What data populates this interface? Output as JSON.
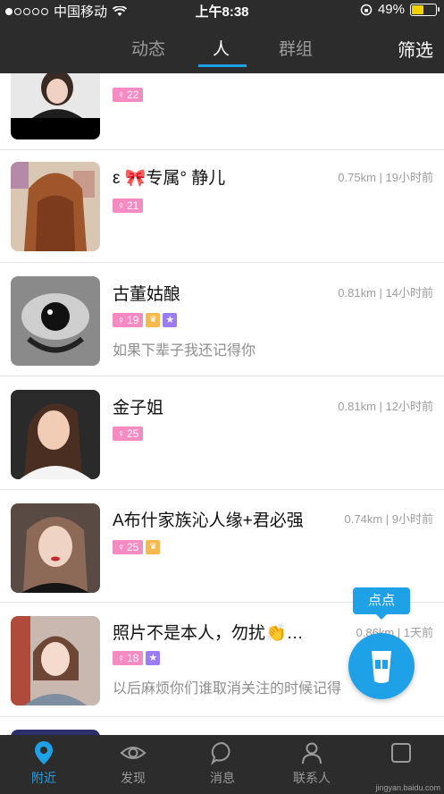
{
  "status_bar": {
    "carrier": "中国移动",
    "time": "上午8:38",
    "battery": "49%",
    "battery_level": 0.49
  },
  "top_nav": {
    "tabs": [
      {
        "label": "动态"
      },
      {
        "label": "人"
      },
      {
        "label": "群组"
      }
    ],
    "active_tab": "人",
    "filter_label": "筛选"
  },
  "people": [
    {
      "name": "",
      "age": "22",
      "distance_time": "",
      "signature": ""
    },
    {
      "name": "ε 🎀专属° 静儿",
      "age": "21",
      "distance_time": "0.75km | 19小时前",
      "signature": ""
    },
    {
      "name": "古董姑酿",
      "age": "19",
      "distance_time": "0.81km | 14小时前",
      "signature": "如果下辈子我还记得你"
    },
    {
      "name": "金子姐",
      "age": "25",
      "distance_time": "0.81km | 12小时前",
      "signature": ""
    },
    {
      "name": "A布什家族沁人缘+君必强",
      "age": "25",
      "distance_time": "0.74km | 9小时前",
      "signature": ""
    },
    {
      "name": "照片不是本人，勿扰👏…",
      "age": "18",
      "distance_time": "0.86km | 1天前",
      "signature": "以后麻烦你们谁取消关注的时候记得"
    }
  ],
  "fab_bubble": "点点",
  "bottom_nav": [
    {
      "label": "附近"
    },
    {
      "label": "发现"
    },
    {
      "label": "消息"
    },
    {
      "label": "联系人"
    },
    {
      "label": ""
    }
  ],
  "watermark": "jingyan.baidu.com",
  "colors": {
    "accent": "#1ea1e6",
    "bar": "#2c2c2c",
    "age_badge": "#f58bc2"
  }
}
